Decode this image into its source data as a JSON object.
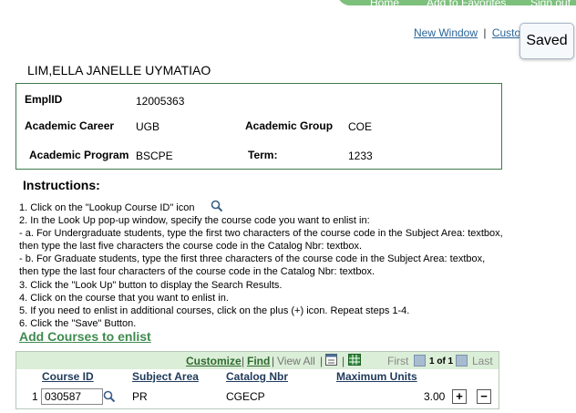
{
  "header": {
    "top_links": [
      "Home",
      "Add to Favorites",
      "Sign out"
    ],
    "new_window": "New Window",
    "customize_page": "Custo",
    "saved_label": "Saved"
  },
  "student": {
    "name": "LIM,ELLA JANELLE UYMATIAO",
    "emplid_label": "EmplID",
    "emplid": "12005363",
    "career_label": "Academic Career",
    "career": "UGB",
    "group_label": "Academic Group",
    "group": "COE",
    "program_label": "Academic Program",
    "program": "BSCPE",
    "term_label": "Term:",
    "term": "1233"
  },
  "instructions": {
    "title": "Instructions:",
    "lines": [
      "1. Click on the \"Lookup Course ID\" icon",
      "2. In the Look Up pop-up window, specify the course code you want to enlist in:",
      "- a. For Undergraduate students, type the first two characters of the course code in the Subject Area: textbox,",
      "then type the last five characters the course code in the Catalog Nbr: textbox.",
      "- b. For Graduate students, type the first three characters of the course code in the Subject Area: textbox,",
      "then type the last four characters of the course code in the Catalog Nbr: textbox.",
      "3. Click the \"Look Up\" button to display the Search Results.",
      "4. Click on the course that you want to enlist in.",
      "5. If you need to enlist in additional courses, click on the plus (+) icon. Repeat steps 1-4.",
      "6. Click the \"Save\" Button."
    ]
  },
  "add_courses": {
    "title": "Add Courses to enlist",
    "toolbar": {
      "customize": "Customize",
      "find": "Find",
      "view_all": "View All",
      "first": "First",
      "range": "1 of 1",
      "last": "Last"
    },
    "columns": [
      "Course ID",
      "Subject Area",
      "Catalog Nbr",
      "Maximum Units"
    ],
    "rows": [
      {
        "num": "1",
        "course_id": "030587",
        "subject": "PR",
        "catalog": "CGECP",
        "units": "3.00"
      }
    ]
  }
}
